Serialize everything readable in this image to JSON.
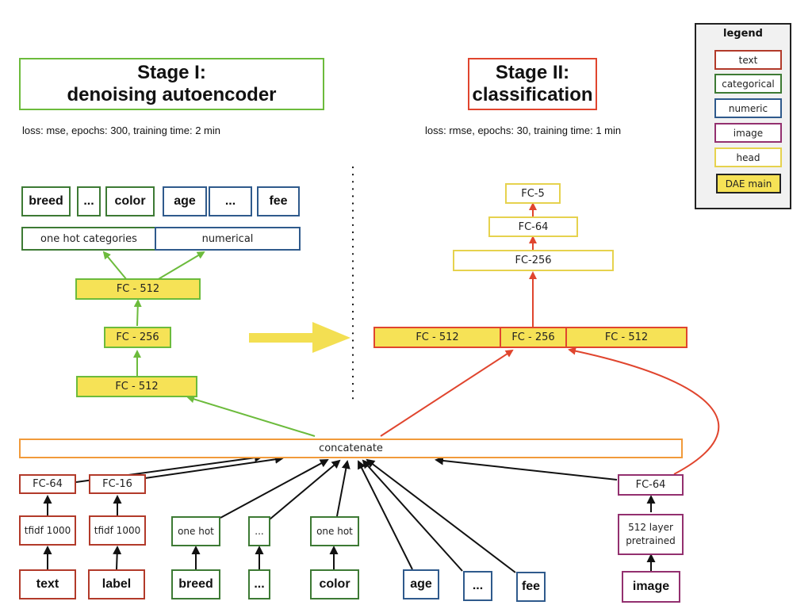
{
  "legend": {
    "title": "legend",
    "items": [
      {
        "label": "text",
        "color": "#b23a2a"
      },
      {
        "label": "categorical",
        "color": "#3d7a34"
      },
      {
        "label": "numeric",
        "color": "#2f5a8c"
      },
      {
        "label": "image",
        "color": "#93306f"
      },
      {
        "label": "head",
        "color": "#e6d24e"
      },
      {
        "label": "DAE main",
        "color": "#f6e256"
      }
    ]
  },
  "stage1": {
    "title_line1": "Stage I:",
    "title_line2": "denoising autoencoder",
    "info": "loss: mse, epochs: 300, training time: 2 min",
    "border_color": "#6cbb3c",
    "outputs": {
      "categorical": [
        "breed",
        "...",
        "color"
      ],
      "numeric": [
        "age",
        "...",
        "fee"
      ],
      "cat_group": "one hot categories",
      "num_group": "numerical"
    },
    "layers": {
      "top": "FC - 512",
      "middle": "FC - 256",
      "bottom": "FC - 512"
    }
  },
  "stage2": {
    "title_line1": "Stage II:",
    "title_line2": "classification",
    "info": "loss: rmse, epochs: 30, training time: 1 min",
    "border_color": "#e0452e",
    "head": [
      "FC-5",
      "FC-64",
      "FC-256"
    ],
    "dae_concat": [
      "FC - 512",
      "FC - 256",
      "FC - 512"
    ]
  },
  "concatenate": "concatenate",
  "inputs": {
    "text": {
      "fc": "FC-64",
      "tfidf": "tfidf 1000",
      "input": "text"
    },
    "label": {
      "fc": "FC-16",
      "tfidf": "tfidf 1000",
      "input": "label"
    },
    "breed": {
      "enc": "one hot",
      "input": "breed"
    },
    "cat_more": {
      "enc": "...",
      "input": "..."
    },
    "color": {
      "enc": "one hot",
      "input": "color"
    },
    "age": {
      "input": "age"
    },
    "num_more": {
      "input": "..."
    },
    "fee": {
      "input": "fee"
    },
    "image": {
      "fc": "FC-64",
      "pretrained": "512 layer pretrained",
      "input": "image"
    }
  },
  "colors": {
    "green_arrow": "#6cbb3c",
    "red_arrow": "#e0452e",
    "black_arrow": "#111111",
    "transfer_arrow": "#f3df52",
    "dae_fill": "#f6e256"
  }
}
